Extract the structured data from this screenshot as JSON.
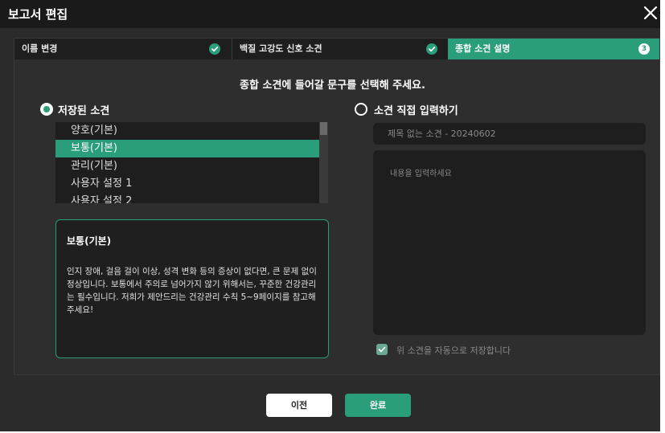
{
  "window": {
    "title": "보고서 편집"
  },
  "steps": [
    {
      "label": "이름 변경",
      "state": "done"
    },
    {
      "label": "백질 고강도 신호 소견",
      "state": "done"
    },
    {
      "label": "종합 소견 설명",
      "state": "current",
      "number": "3"
    }
  ],
  "instruction": "종합 소견에 들어갈 문구를 선택해 주세요.",
  "saved": {
    "option_label": "저장된 소견",
    "selected": true,
    "items": [
      {
        "label": "양호(기본)"
      },
      {
        "label": "보통(기본)",
        "selected": true
      },
      {
        "label": "관리(기본)"
      },
      {
        "label": "사용자 설정 1"
      },
      {
        "label": "사용자 설정 2"
      }
    ]
  },
  "preview": {
    "title": "보통(기본)",
    "body": "인지 장애, 걸음 걸이 이상, 성격 변화 등의 증상이 없다면, 큰 문제 없이 정상입니다. 보통에서 주의로 넘어가지 않기 위해서는, 꾸준한 건강관리는 필수입니다. 저희가  제안드리는 건강관리 수칙 5~9페이지를 참고해주세요!"
  },
  "manual": {
    "option_label": "소견 직접 입력하기",
    "selected": false,
    "title_placeholder": "제목 없는 소견 - 20240602",
    "content_placeholder": "내용을 입력하세요",
    "autosave_label": "위 소견을 자동으로 저장합니다",
    "autosave_checked": true
  },
  "buttons": {
    "prev": "이전",
    "done": "완료"
  },
  "colors": {
    "accent": "#2a9d7b",
    "background": "#2b2b2b",
    "titlebar": "#1a1a1a"
  },
  "icons": {
    "close": "close-icon",
    "step_done": "check-circle-icon",
    "radio_on": "radio-selected-icon",
    "radio_off": "radio-empty-icon",
    "checkbox": "checkmark-icon"
  }
}
